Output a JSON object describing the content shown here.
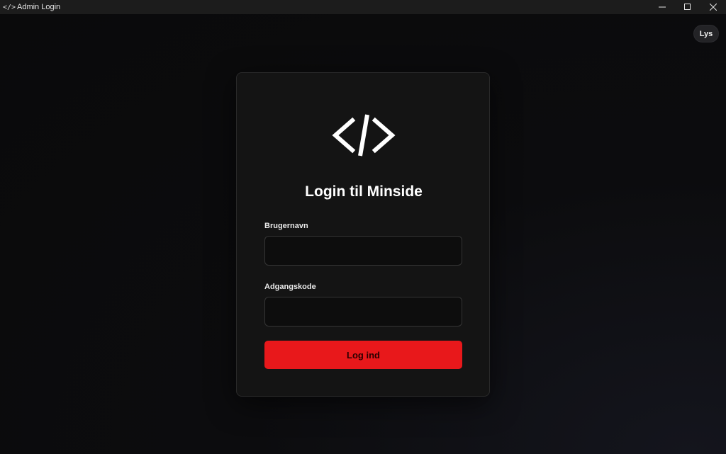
{
  "window": {
    "app_icon": "</>",
    "title": "Admin Login"
  },
  "theme_toggle": {
    "label": "Lys"
  },
  "login": {
    "logo_icon": "code-brackets-icon",
    "heading": "Login til Minside",
    "username_label": "Brugernavn",
    "username_value": "",
    "password_label": "Adgangskode",
    "password_value": "",
    "submit_label": "Log ind"
  },
  "colors": {
    "accent": "#e8181b",
    "card_bg": "#141414",
    "page_bg": "#0b0b0c"
  }
}
